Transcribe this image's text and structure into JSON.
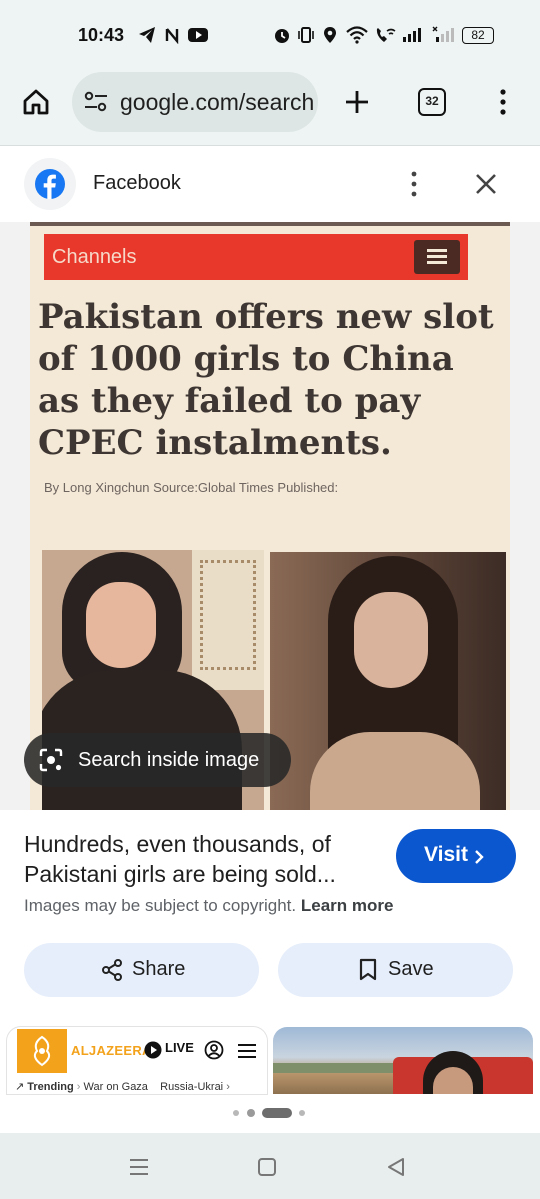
{
  "status_bar": {
    "time": "10:43",
    "battery": "82",
    "left_icons": [
      "telegram-icon",
      "nfc-icon",
      "youtube-icon"
    ],
    "right_icons": [
      "alarm-icon",
      "vibrate-icon",
      "location-icon",
      "wifi-icon",
      "wifi-call-icon",
      "signal-icon",
      "signal-weak-icon",
      "battery-icon"
    ]
  },
  "browser": {
    "url": "google.com/search",
    "tab_count": "32",
    "icons": [
      "home-icon",
      "site-settings-icon",
      "new-tab-icon",
      "tabs-icon",
      "more-icon"
    ]
  },
  "sheet": {
    "source_name": "Facebook",
    "source_icon": "facebook-icon"
  },
  "image": {
    "channels_label": "Channels",
    "headline": "Pakistan offers new slot of 1000 girls to China as they failed to pay CPEC instalments.",
    "byline": "By Long Xingchun Source:Global Times Published:",
    "lens_label": "Search inside image"
  },
  "result": {
    "title": "Hundreds, even thousands, of Pakistani girls are being sold...",
    "visit_label": "Visit",
    "copyright_text": "Images may be subject to copyright.",
    "learn_more": "Learn more",
    "share_label": "Share",
    "save_label": "Save"
  },
  "related": {
    "aljazeera_brand": "ALJAZEERA",
    "live_label": "LIVE",
    "nav_items": [
      "Trending",
      "War on Gaza",
      "Russia-Ukrai"
    ]
  },
  "colors": {
    "accent_blue": "#0b57d0",
    "chrome_bg": "#eef4f3",
    "pill_bg": "#e6eefb",
    "facebook_blue": "#1877f2",
    "aljazeera_orange": "#f3a21b",
    "channels_red": "#e8382c"
  }
}
